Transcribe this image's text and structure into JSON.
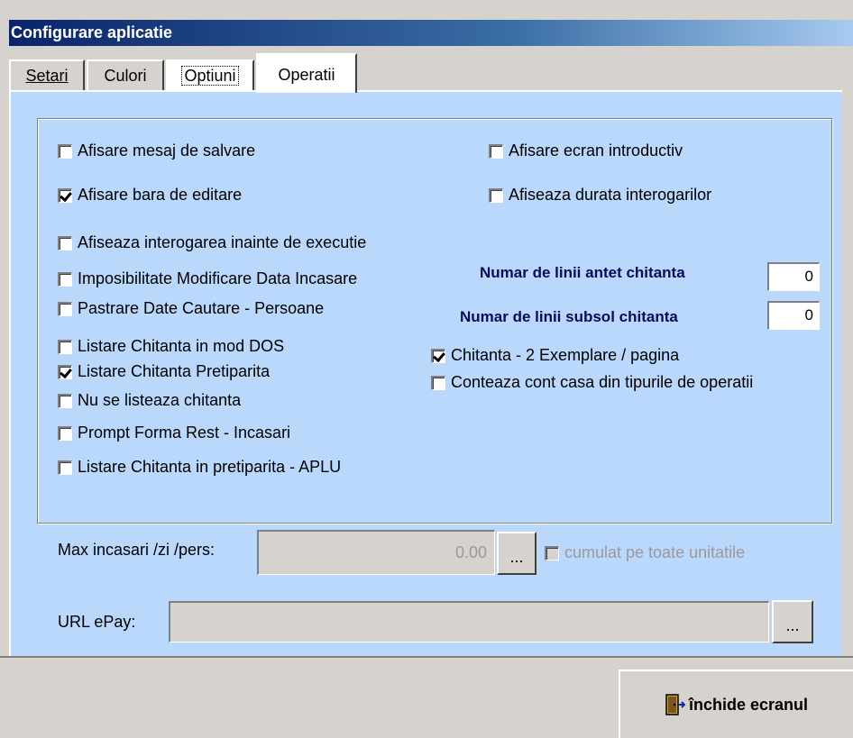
{
  "window": {
    "title": "Configurare aplicatie"
  },
  "tabs": [
    {
      "label": "Setari"
    },
    {
      "label": "Culori"
    },
    {
      "label": "Optiuni"
    },
    {
      "label": "Operatii"
    }
  ],
  "left_options": [
    {
      "label": "Afisare mesaj de salvare",
      "checked": false
    },
    {
      "label": "Afisare bara de editare",
      "checked": true
    },
    {
      "label": "Afiseaza interogarea inainte de executie",
      "checked": false
    },
    {
      "label": "Imposibilitate Modificare Data Incasare",
      "checked": false
    },
    {
      "label": "Pastrare Date Cautare - Persoane",
      "checked": false
    },
    {
      "label": "Listare Chitanta in mod DOS",
      "checked": false
    },
    {
      "label": "Listare Chitanta Pretiparita",
      "checked": true
    },
    {
      "label": "Nu se listeaza chitanta",
      "checked": false
    },
    {
      "label": "Prompt Forma Rest - Incasari",
      "checked": false
    },
    {
      "label": "Listare Chitanta in pretiparita - APLU",
      "checked": false
    }
  ],
  "right_options": [
    {
      "label": "Afisare ecran introductiv",
      "checked": false
    },
    {
      "label": "Afiseaza durata interogarilor",
      "checked": false
    },
    {
      "label": "Chitanta - 2 Exemplare / pagina",
      "checked": true
    },
    {
      "label": "Conteaza cont casa din tipurile de operatii",
      "checked": false
    }
  ],
  "antet": {
    "label": "Numar de linii antet chitanta",
    "value": "0"
  },
  "subsol": {
    "label": "Numar de linii subsol chitanta",
    "value": "0"
  },
  "max_incasari": {
    "label": "Max incasari /zi /pers:",
    "value": "0.00",
    "browse": "...",
    "cumulat_label": "cumulat pe toate unitatile",
    "cumulat_checked": false
  },
  "url_epay": {
    "label": "URL ePay:",
    "value": "",
    "browse": "..."
  },
  "close_button": {
    "label": "închide ecranul"
  },
  "colors": {
    "title_bg": "#0a246a",
    "panel_bg": "#b9d8fc",
    "form_bg": "#d6d3ce"
  }
}
